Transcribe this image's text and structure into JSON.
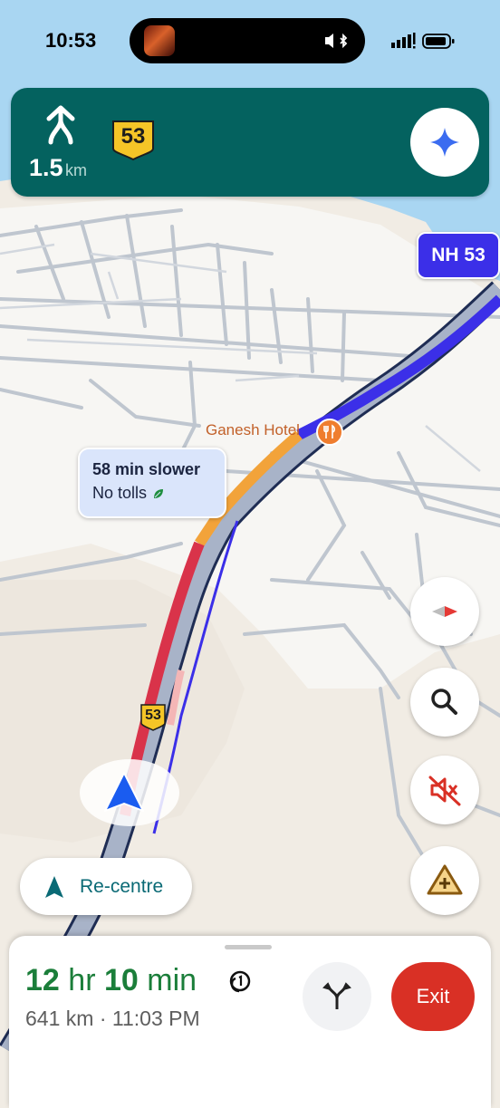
{
  "status_bar": {
    "time": "10:53"
  },
  "banner": {
    "distance_value": "1.5",
    "distance_unit": "km",
    "road_shield": "53",
    "maneuver_icon": "merge-icon",
    "assistant_icon": "sparkle-icon",
    "bg_color": "#04625f"
  },
  "map": {
    "highway_label": "NH 53",
    "poi_name": "Ganesh Hotel",
    "poi_icon": "restaurant-icon",
    "route_callout": {
      "line1": "58 min slower",
      "line2": "No tolls"
    },
    "road_shield_small": "53"
  },
  "controls": {
    "compass_icon": "compass-icon",
    "search_icon": "search-icon",
    "mute_icon": "sound-off-icon",
    "report_icon": "report-incident-icon",
    "recentre_label": "Re-centre"
  },
  "trip": {
    "eta_hours": "12",
    "eta_hr_label": "hr",
    "eta_minutes": "10",
    "eta_min_label": "min",
    "distance": "641 km",
    "separator": "·",
    "arrival_time": "11:03 PM",
    "exit_label": "Exit"
  },
  "colors": {
    "route_primary": "#3b2fe8",
    "slow": "#d9334a",
    "medium": "#f2a33a",
    "exit": "#d93025",
    "eta": "#1b7e3a"
  }
}
